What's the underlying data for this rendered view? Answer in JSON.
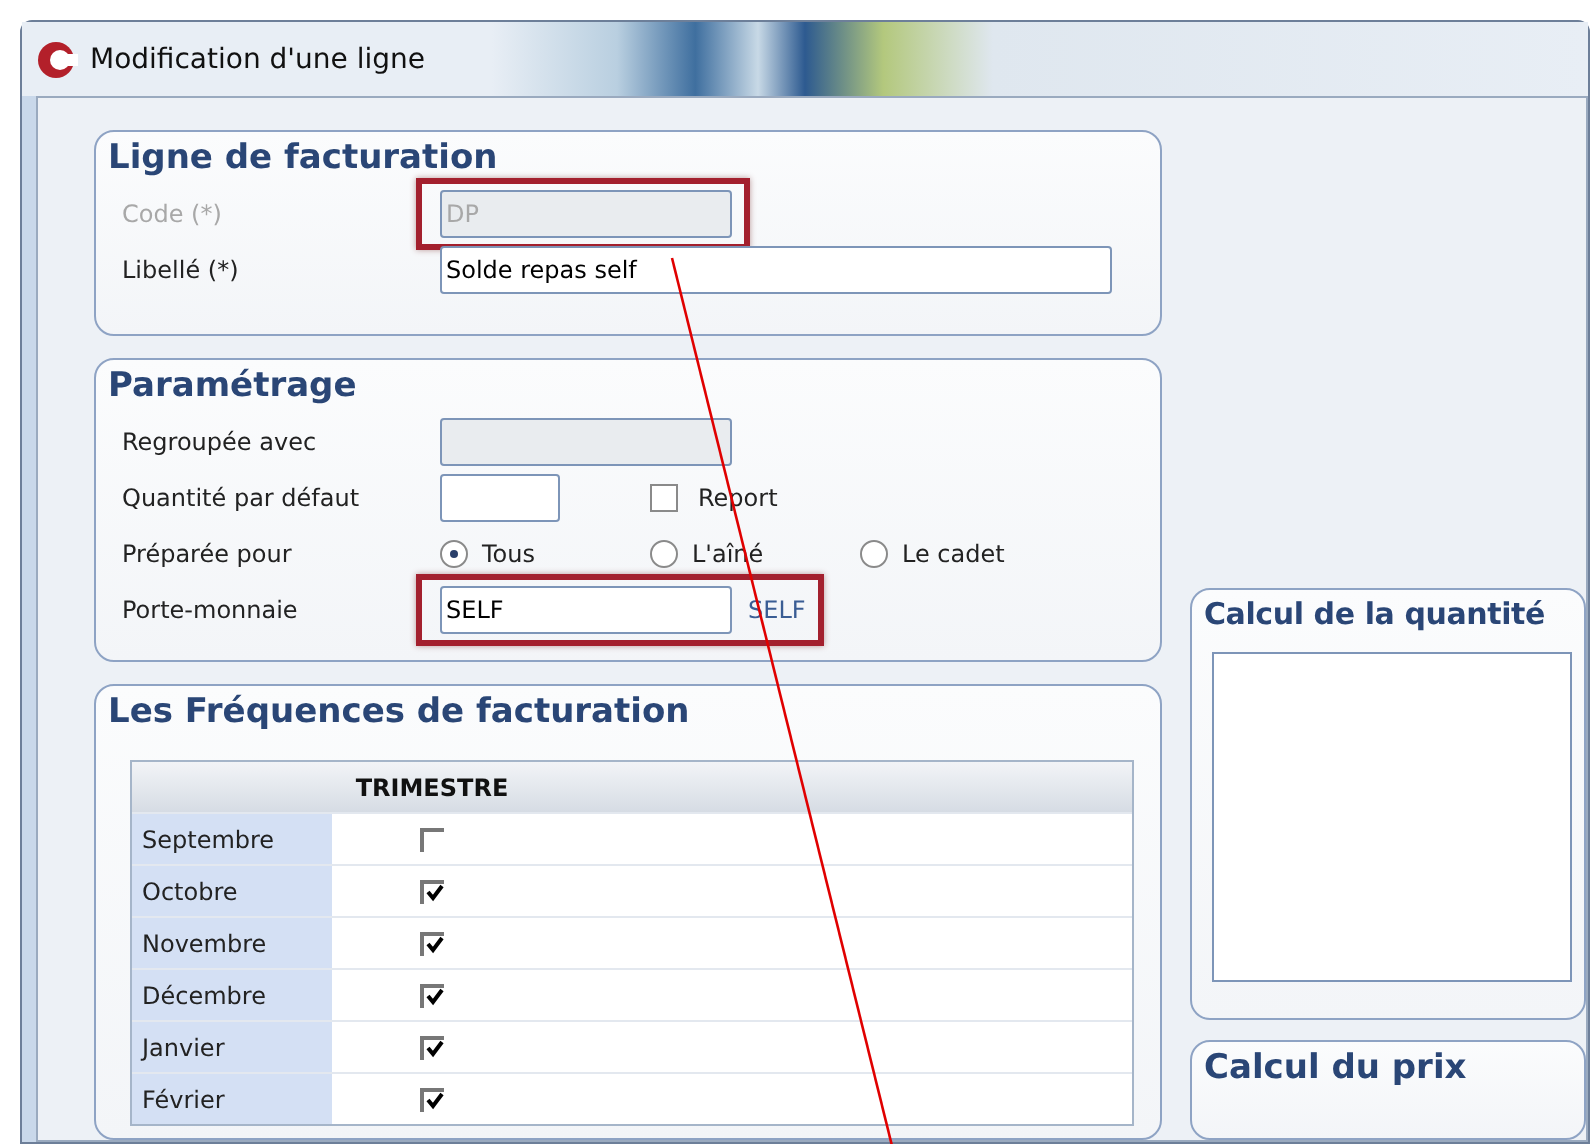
{
  "window": {
    "title": "Modification d'une ligne"
  },
  "ligne_de_facturation": {
    "title": "Ligne de facturation",
    "fields": [
      {
        "label": "Code (*)",
        "value": "DP",
        "disabled": true,
        "highlighted": true
      },
      {
        "label": "Libellé (*)",
        "value": "Solde repas self",
        "disabled": false
      }
    ]
  },
  "parametrage": {
    "title": "Paramétrage",
    "regroupee_avec": {
      "label": "Regroupée avec",
      "disabled": true
    },
    "quantite_par_defaut": {
      "label": "Quantité par défaut"
    },
    "report": {
      "label": "Report",
      "checked": false
    },
    "preparee_pour": {
      "label": "Préparée pour",
      "options": [
        {
          "label": "Tous",
          "selected": true
        },
        {
          "label": "L'aîné",
          "selected": false
        },
        {
          "label": "Le cadet",
          "selected": false
        }
      ]
    },
    "porte_monnaie": {
      "label": "Porte-monnaie",
      "value": "SELF",
      "code": "SELF",
      "highlighted": true
    }
  },
  "frequences": {
    "title": "Les Fréquences de facturation",
    "columns": [
      "TRIMESTRE"
    ],
    "rows": [
      {
        "month": "Septembre",
        "checked": false
      },
      {
        "month": "Octobre",
        "checked": true
      },
      {
        "month": "Novembre",
        "checked": true
      },
      {
        "month": "Décembre",
        "checked": true
      },
      {
        "month": "Janvier",
        "checked": true
      },
      {
        "month": "Février",
        "checked": true
      }
    ]
  },
  "calcul_quantite": {
    "title": "Calcul de la quantité"
  },
  "calcul_prix": {
    "title": "Calcul du prix"
  }
}
